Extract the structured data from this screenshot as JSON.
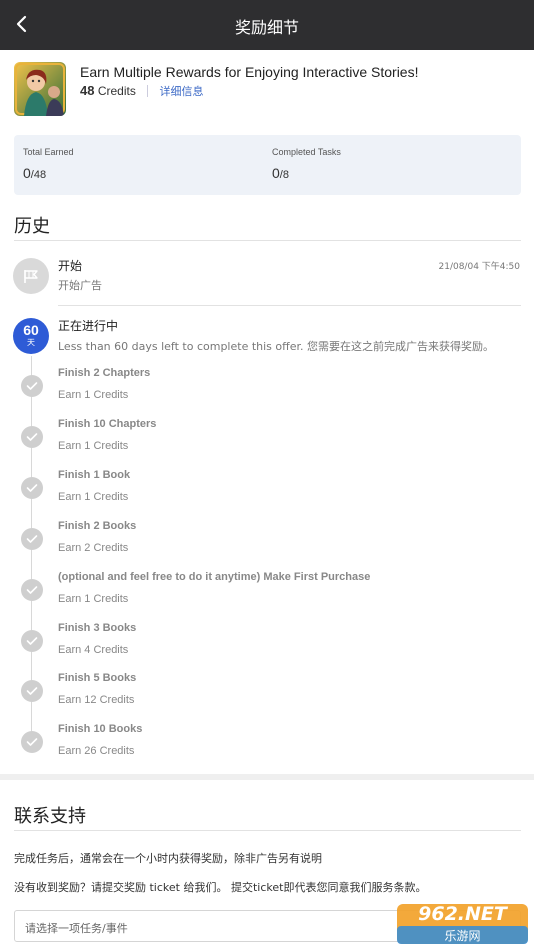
{
  "header": {
    "title": "奖励细节",
    "back_icon": "chevron-left-icon"
  },
  "offer": {
    "title": "Earn Multiple Rewards for Enjoying Interactive Stories!",
    "credits_value": "48",
    "credits_unit": "Credits",
    "detail_link": "详细信息"
  },
  "stats": {
    "total_earned": {
      "label": "Total Earned",
      "value": "0",
      "total": "/48"
    },
    "completed_tasks": {
      "label": "Completed Tasks",
      "value": "0",
      "total": "/8"
    }
  },
  "history": {
    "heading": "历史",
    "start_event": {
      "title": "开始",
      "subtitle": "开始广告",
      "time": "21/08/04 下午4:50",
      "icon": "flag-icon"
    },
    "progress_event": {
      "days": "60",
      "days_unit": "天",
      "title": "正在进行中",
      "subtitle": "Less than 60 days left to complete this offer. 您需要在这之前完成广告来获得奖励。"
    },
    "tasks": [
      {
        "name": "Finish 2 Chapters",
        "credits": "Earn 1 Credits"
      },
      {
        "name": "Finish 10 Chapters",
        "credits": "Earn 1 Credits"
      },
      {
        "name": "Finish 1 Book",
        "credits": "Earn 1 Credits"
      },
      {
        "name": "Finish 2 Books",
        "credits": "Earn 2 Credits"
      },
      {
        "name": "(optional and feel free to do it anytime) Make First Purchase",
        "credits": "Earn 1 Credits"
      },
      {
        "name": "Finish 3 Books",
        "credits": "Earn 4 Credits"
      },
      {
        "name": "Finish 5 Books",
        "credits": "Earn 12 Credits"
      },
      {
        "name": "Finish 10 Books",
        "credits": "Earn 26 Credits"
      }
    ]
  },
  "support": {
    "heading": "联系支持",
    "line1": "完成任务后，通常会在一个小时内获得奖励，除非广告另有说明",
    "line2": "没有收到奖励？请提交奖励 ticket 给我们。 提交ticket即代表您同意我们服务条款。",
    "select_placeholder": "请选择一项任务/事件"
  },
  "watermark": {
    "brand": "962.NET",
    "subtitle": "乐游网"
  },
  "colors": {
    "header_bg": "#2e2e30",
    "accent": "#2e5bd6",
    "link": "#3d6ac6",
    "stats_bg": "#eef2f8"
  }
}
